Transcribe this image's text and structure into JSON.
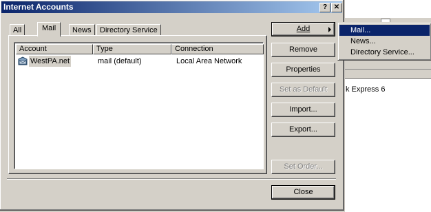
{
  "background": {
    "partial_text": "k Express 6"
  },
  "dialog": {
    "title": "Internet Accounts",
    "help_button": "?",
    "close_button": "✕"
  },
  "tabs": [
    {
      "label": "All"
    },
    {
      "label": "Mail",
      "selected": true
    },
    {
      "label": "News"
    },
    {
      "label": "Directory Service"
    }
  ],
  "list": {
    "columns": [
      "Account",
      "Type",
      "Connection"
    ],
    "rows": [
      {
        "account": "WestPA.net",
        "type": "mail (default)",
        "connection": "Local Area Network"
      }
    ]
  },
  "buttons": {
    "add": "Add",
    "remove": "Remove",
    "properties": "Properties",
    "set_default": "Set as Default",
    "import": "Import...",
    "export": "Export...",
    "set_order": "Set Order...",
    "close": "Close"
  },
  "add_menu": {
    "items": [
      "Mail...",
      "News...",
      "Directory Service..."
    ]
  },
  "colors": {
    "title_bar_start": "#0a246a",
    "title_bar_end": "#a6caf0",
    "face": "#d4d0c8",
    "highlight": "#0a246a"
  }
}
